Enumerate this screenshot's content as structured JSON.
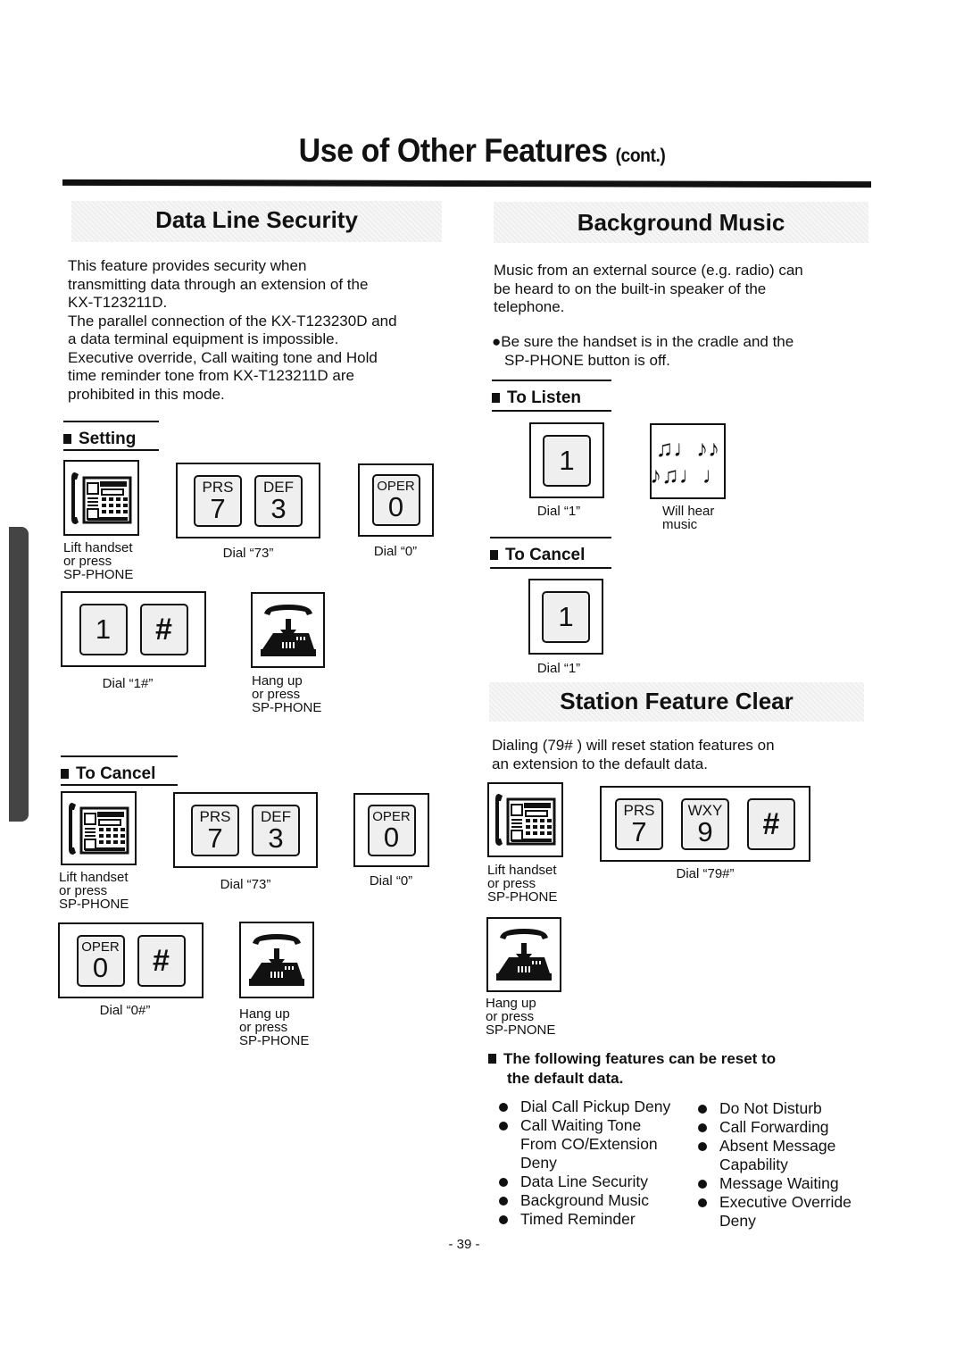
{
  "page": {
    "title": "Use of Other Features",
    "title_suffix": "(cont.)",
    "page_number": "- 39 -"
  },
  "data_line_security": {
    "heading": "Data Line Security",
    "description": [
      "This feature provides security when",
      "transmitting data through an extension of the",
      "KX-T123211D.",
      "The parallel connection of the KX-T123230D and",
      "a data terminal equipment is impossible.",
      "Executive override, Call waiting tone and Hold",
      "time reminder tone from KX-T123211D are",
      "prohibited in this mode."
    ],
    "setting": {
      "label": "Setting",
      "steps": [
        {
          "icon": "lift-handset-icon",
          "caption": [
            "Lift handset",
            "or press",
            "SP-PHONE"
          ]
        },
        {
          "keys": [
            {
              "letters": "PRS",
              "digit": "7"
            },
            {
              "letters": "DEF",
              "digit": "3"
            }
          ],
          "caption": "Dial “73”"
        },
        {
          "keys": [
            {
              "letters": "OPER",
              "digit": "0"
            }
          ],
          "caption": "Dial “0”"
        },
        {
          "keys": [
            {
              "letters": "",
              "digit": "1"
            },
            {
              "letters": "",
              "digit": "#"
            }
          ],
          "caption": "Dial “1#”"
        },
        {
          "icon": "hang-up-icon",
          "caption": [
            "Hang up",
            "or press",
            "SP-PHONE"
          ]
        }
      ]
    },
    "cancel": {
      "label": "To Cancel",
      "steps": [
        {
          "icon": "lift-handset-icon",
          "caption": [
            "Lift handset",
            "or press",
            "SP-PHONE"
          ]
        },
        {
          "keys": [
            {
              "letters": "PRS",
              "digit": "7"
            },
            {
              "letters": "DEF",
              "digit": "3"
            }
          ],
          "caption": "Dial “73”"
        },
        {
          "keys": [
            {
              "letters": "OPER",
              "digit": "0"
            }
          ],
          "caption": "Dial “0”"
        },
        {
          "keys": [
            {
              "letters": "OPER",
              "digit": "0"
            },
            {
              "letters": "",
              "digit": "#"
            }
          ],
          "caption": "Dial “0#”"
        },
        {
          "icon": "hang-up-icon",
          "caption": [
            "Hang up",
            "or press",
            "SP-PHONE"
          ]
        }
      ]
    }
  },
  "background_music": {
    "heading": "Background Music",
    "description": [
      "Music from an external source  (e.g. radio) can",
      "be heard to on the built-in speaker of the",
      "telephone."
    ],
    "note": [
      "●Be sure the handset is in the cradle and the",
      "SP-PHONE button is off."
    ],
    "listen": {
      "label": "To Listen",
      "steps": [
        {
          "keys": [
            {
              "letters": "",
              "digit": "1"
            }
          ],
          "caption": "Dial “1”"
        },
        {
          "icon": "music-notes-icon",
          "notes_row1": "♫♩♪♪",
          "notes_row2": "♪♫♩♩",
          "caption": [
            "Will hear",
            "music"
          ]
        }
      ]
    },
    "cancel": {
      "label": "To Cancel",
      "steps": [
        {
          "keys": [
            {
              "letters": "",
              "digit": "1"
            }
          ],
          "caption": "Dial “1”"
        }
      ]
    }
  },
  "station_feature_clear": {
    "heading": "Station Feature Clear",
    "description": [
      "Dialing (79# ) will reset station features on",
      "an extension to the default data."
    ],
    "steps": [
      {
        "icon": "lift-handset-icon",
        "caption": [
          "Lift handset",
          "or press",
          "SP-PHONE"
        ]
      },
      {
        "keys": [
          {
            "letters": "PRS",
            "digit": "7"
          },
          {
            "letters": "WXY",
            "digit": "9"
          },
          {
            "letters": "",
            "digit": "#"
          }
        ],
        "caption": "Dial “79#”"
      },
      {
        "icon": "hang-up-icon",
        "caption": [
          "Hang up",
          "or press",
          "SP-PNONE"
        ]
      }
    ],
    "reset_heading": [
      "The following features can be reset to",
      "the default data."
    ],
    "features_left": [
      {
        "text": "Dial Call Pickup Deny",
        "bullet": true
      },
      {
        "text": "Call Waiting Tone",
        "bullet": true
      },
      {
        "text": "From CO/Extension",
        "bullet": false
      },
      {
        "text": "Deny",
        "bullet": false
      },
      {
        "text": "Data Line Security",
        "bullet": true
      },
      {
        "text": "Background Music",
        "bullet": true
      },
      {
        "text": "Timed Reminder",
        "bullet": true
      }
    ],
    "features_right": [
      {
        "text": "Do Not Disturb",
        "bullet": true
      },
      {
        "text": "Call Forwarding",
        "bullet": true
      },
      {
        "text": "Absent Message",
        "bullet": true
      },
      {
        "text": "Capability",
        "bullet": false
      },
      {
        "text": "Message Waiting",
        "bullet": true
      },
      {
        "text": "Executive Override",
        "bullet": true
      },
      {
        "text": "Deny",
        "bullet": false
      }
    ]
  }
}
